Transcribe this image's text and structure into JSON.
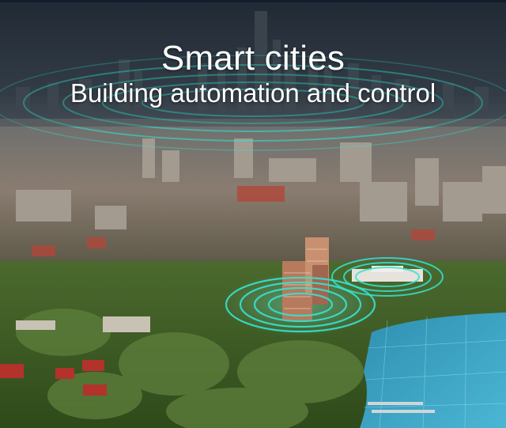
{
  "title": "Smart cities",
  "subtitle": "Building automation and control",
  "colors": {
    "sky": "#2a3440",
    "haze": "#5f6a72",
    "signal_ring": "#35e3d0",
    "lake": "#3aa6c7",
    "vegetation": "#3f6a24"
  }
}
